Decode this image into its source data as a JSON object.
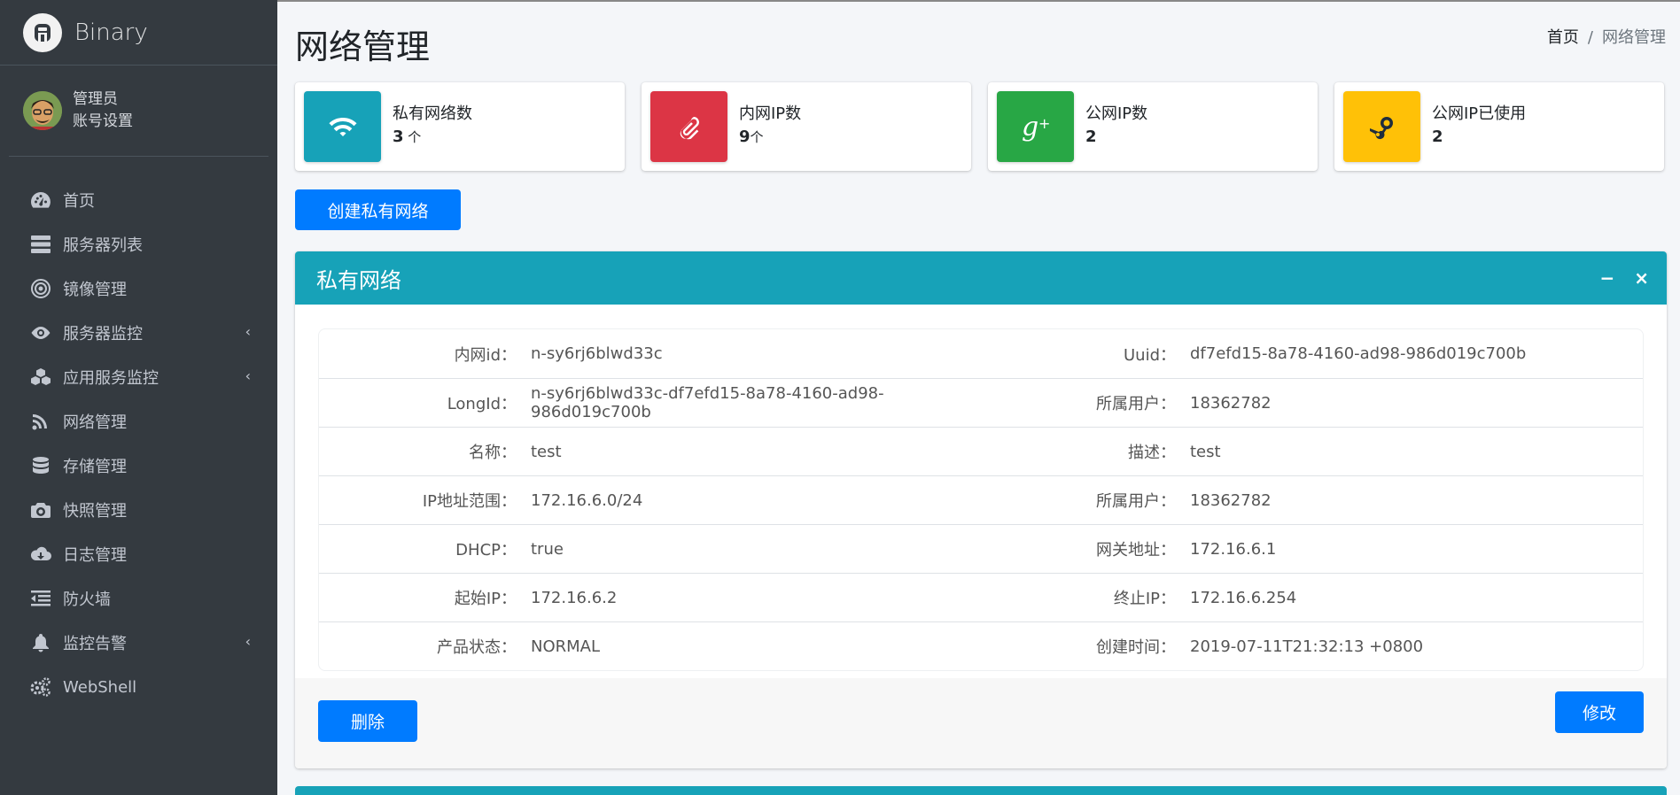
{
  "brand": {
    "name": "Binary"
  },
  "user": {
    "name": "管理员",
    "settings_link": "账号设置"
  },
  "sidebar": {
    "items": [
      {
        "label": "首页",
        "icon": "dashboard-icon",
        "has_submenu": false
      },
      {
        "label": "服务器列表",
        "icon": "server-icon",
        "has_submenu": false
      },
      {
        "label": "镜像管理",
        "icon": "bullseye-icon",
        "has_submenu": false
      },
      {
        "label": "服务器监控",
        "icon": "eye-icon",
        "has_submenu": true
      },
      {
        "label": "应用服务监控",
        "icon": "cubes-icon",
        "has_submenu": true
      },
      {
        "label": "网络管理",
        "icon": "rss-icon",
        "has_submenu": false
      },
      {
        "label": "存储管理",
        "icon": "database-icon",
        "has_submenu": false
      },
      {
        "label": "快照管理",
        "icon": "camera-icon",
        "has_submenu": false
      },
      {
        "label": "日志管理",
        "icon": "cloud-download-icon",
        "has_submenu": false
      },
      {
        "label": "防火墙",
        "icon": "outdent-icon",
        "has_submenu": false
      },
      {
        "label": "监控告警",
        "icon": "bell-icon",
        "has_submenu": true
      },
      {
        "label": "WebShell",
        "icon": "cogs-icon",
        "has_submenu": false
      }
    ],
    "chevron": "‹"
  },
  "page": {
    "title": "网络管理"
  },
  "breadcrumb": {
    "home": "首页",
    "separator": "/",
    "current": "网络管理"
  },
  "info_boxes": [
    {
      "label": "私有网络数",
      "value": "3",
      "unit": " 个",
      "color": "#17a2b8",
      "icon": "wifi-icon"
    },
    {
      "label": "内网IP数",
      "value": "9",
      "unit": "个",
      "color": "#dc3545",
      "icon": "paperclip-icon"
    },
    {
      "label": "公网IP数",
      "value": "2",
      "unit": "",
      "color": "#28a745",
      "icon": "google-plus-icon"
    },
    {
      "label": "公网IP已使用",
      "value": "2",
      "unit": "",
      "color": "#ffc107",
      "icon": "steam-icon"
    }
  ],
  "create_button": "创建私有网络",
  "card": {
    "title": "私有网络",
    "minimize": "−",
    "close": "×",
    "rows": [
      {
        "l1": "内网id：",
        "v1": "n-sy6rj6blwd33c",
        "l2": "Uuid：",
        "v2": "df7efd15-8a78-4160-ad98-986d019c700b"
      },
      {
        "l1": "LongId：",
        "v1": "n-sy6rj6blwd33c-df7efd15-8a78-4160-ad98-986d019c700b",
        "l2": "所属用户：",
        "v2": "18362782"
      },
      {
        "l1": "名称：",
        "v1": "test",
        "l2": "描述：",
        "v2": "test"
      },
      {
        "l1": "IP地址范围：",
        "v1": "172.16.6.0/24",
        "l2": "所属用户：",
        "v2": "18362782"
      },
      {
        "l1": "DHCP：",
        "v1": "true",
        "l2": "网关地址：",
        "v2": "172.16.6.1"
      },
      {
        "l1": "起始IP：",
        "v1": "172.16.6.2",
        "l2": "终止IP：",
        "v2": "172.16.6.254"
      },
      {
        "l1": "产品状态：",
        "v1": "NORMAL",
        "l2": "创建时间：",
        "v2": "2019-07-11T21:32:13 +0800"
      }
    ],
    "delete_button": "删除",
    "edit_button": "修改"
  }
}
